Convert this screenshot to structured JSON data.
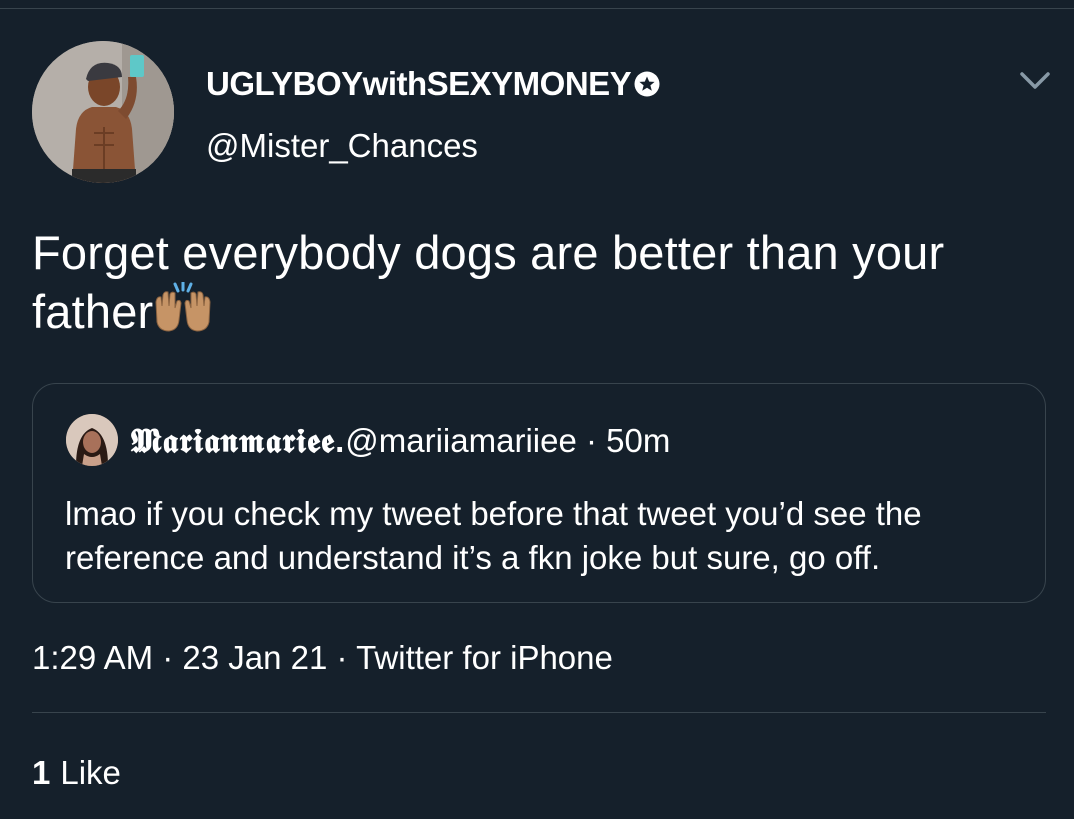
{
  "tweet": {
    "display_name": "UGLYBOYwithSEXYMONEY",
    "handle": "@Mister_Chances",
    "text": "Forget everybody dogs are better than your father",
    "emoji": "🙌🏽",
    "timestamp": "1:29 AM · 23 Jan 21 · Twitter for iPhone",
    "likes_count": "1",
    "likes_label": "Like"
  },
  "quote": {
    "display_name": "𝕸𝖆𝖗𝖎𝖆𝖓𝖒𝖆𝖗𝖎𝖊𝖊.",
    "meta": " @mariiamariiee · 50m",
    "text": "lmao if you check my tweet before that tweet you’d see the reference and understand it’s a fkn joke but sure, go off."
  },
  "colors": {
    "background": "#15202b",
    "border": "#38444d",
    "text": "#ffffff"
  },
  "icons": {
    "badge": "star-badge-icon",
    "chevron": "chevron-down-icon"
  }
}
